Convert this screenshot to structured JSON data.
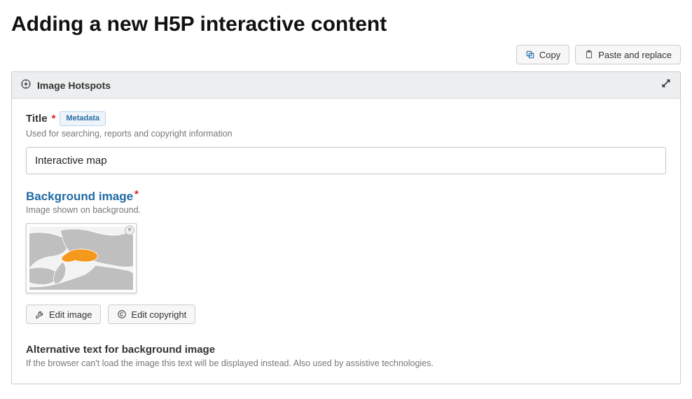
{
  "page": {
    "title": "Adding a new H5P interactive content"
  },
  "actions": {
    "copy": "Copy",
    "paste_replace": "Paste and replace"
  },
  "panel": {
    "type": "Image Hotspots"
  },
  "title_field": {
    "label": "Title",
    "metadata_badge": "Metadata",
    "description": "Used for searching, reports and copyright information",
    "value": "Interactive map"
  },
  "background": {
    "label": "Background image",
    "description": "Image shown on background.",
    "edit_image": "Edit image",
    "edit_copyright": "Edit copyright"
  },
  "alt_text": {
    "label": "Alternative text for background image",
    "description": "If the browser can't load the image this text will be displayed instead. Also used by assistive technologies."
  }
}
